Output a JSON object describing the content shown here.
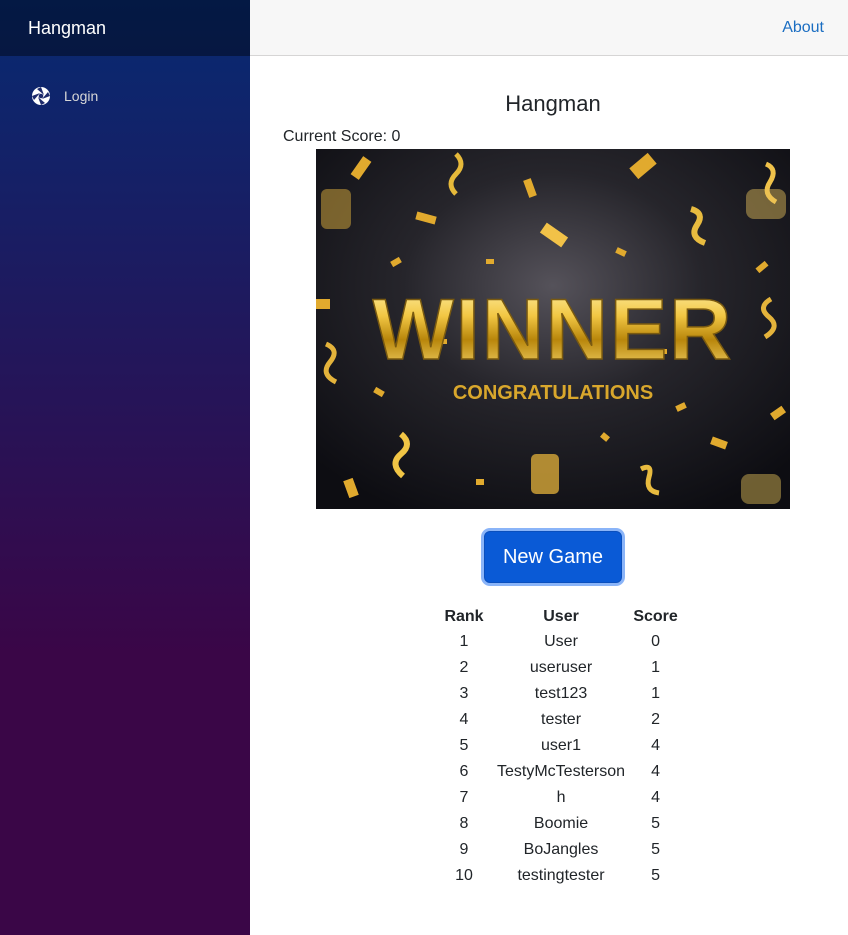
{
  "sidebar": {
    "brand": "Hangman",
    "nav": [
      {
        "label": "Login",
        "icon": "aperture-icon"
      }
    ]
  },
  "topbar": {
    "about": "About"
  },
  "main": {
    "title": "Hangman",
    "score_label": "Current Score: 0",
    "image": {
      "main_text": "WINNER",
      "sub_text": "CONGRATULATIONS"
    },
    "new_game_label": "New Game",
    "leaderboard": {
      "headers": [
        "Rank",
        "User",
        "Score"
      ],
      "rows": [
        [
          "1",
          "User",
          "0"
        ],
        [
          "2",
          "useruser",
          "1"
        ],
        [
          "3",
          "test123",
          "1"
        ],
        [
          "4",
          "tester",
          "2"
        ],
        [
          "5",
          "user1",
          "4"
        ],
        [
          "6",
          "TestyMcTesterson",
          "4"
        ],
        [
          "7",
          "h",
          "4"
        ],
        [
          "8",
          "Boomie",
          "5"
        ],
        [
          "9",
          "BoJangles",
          "5"
        ],
        [
          "10",
          "testingtester",
          "5"
        ]
      ]
    }
  },
  "colors": {
    "sidebar_top": "#072a72",
    "sidebar_bottom": "#3a0647",
    "link": "#1b6ec2",
    "button": "#0a5ad6",
    "gold": "#e8b931"
  }
}
